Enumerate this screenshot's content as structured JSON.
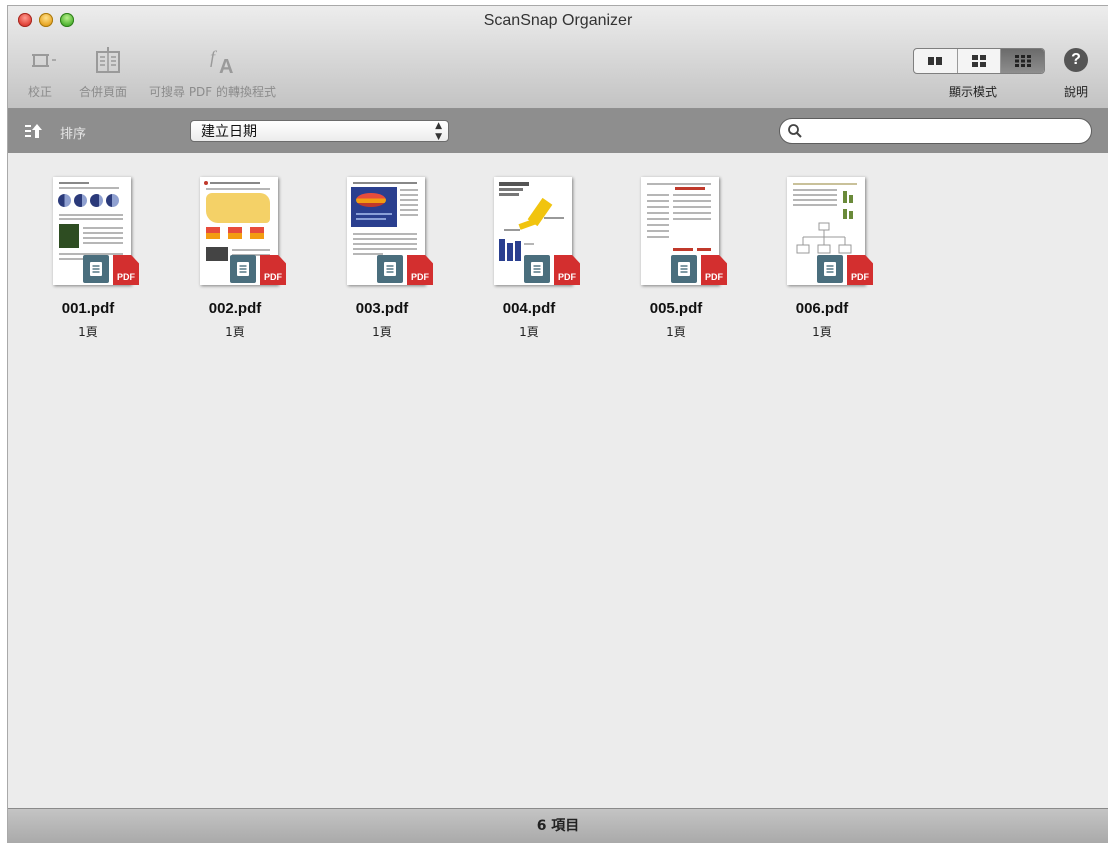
{
  "window": {
    "title": "ScanSnap Organizer"
  },
  "toolbar": {
    "correct_label": "校正",
    "merge_label": "合併頁面",
    "convert_label": "可搜尋 PDF 的轉換程式",
    "view_mode_label": "顯示模式",
    "help_label": "說明",
    "help_glyph": "?"
  },
  "filterbar": {
    "sort_label": "排序",
    "sort_select_value": "建立日期",
    "search_placeholder": "",
    "search_value": ""
  },
  "files": [
    {
      "name": "001.pdf",
      "pages": "1頁"
    },
    {
      "name": "002.pdf",
      "pages": "1頁"
    },
    {
      "name": "003.pdf",
      "pages": "1頁"
    },
    {
      "name": "004.pdf",
      "pages": "1頁"
    },
    {
      "name": "005.pdf",
      "pages": "1頁"
    },
    {
      "name": "006.pdf",
      "pages": "1頁"
    }
  ],
  "badges": {
    "pdf_label": "PDF"
  },
  "status": {
    "item_count": "6 項目"
  },
  "colors": {
    "pdf_badge": "#d32f2f",
    "doc_badge": "#4a6e7d",
    "toolbar_bg": "#d6d6d6",
    "filterbar_bg": "#8e8e8e",
    "content_bg": "#ececec"
  },
  "icons": {
    "correct": "crop-frame-icon",
    "merge": "merge-pages-icon",
    "convert": "font-convert-icon",
    "sort": "sort-ascending-icon",
    "search": "search-icon",
    "help": "help-icon",
    "view_list": "view-columns-icon",
    "view_medium": "view-grid-medium-icon",
    "view_small": "view-grid-small-icon"
  }
}
